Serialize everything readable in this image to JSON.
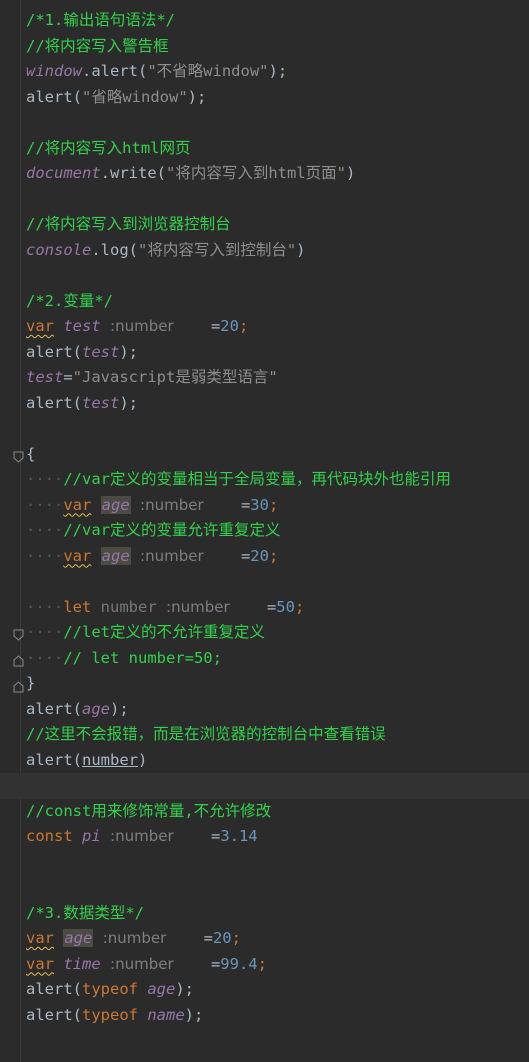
{
  "lines": {
    "l1": "/*1.输出语句语法*/",
    "l2": "//将内容写入警告框",
    "l3a": "window",
    "l3b": ".alert(",
    "l3c": "\"不省略window\"",
    "l3d": ");",
    "l4a": "alert(",
    "l4b": "\"省略window\"",
    "l4c": ");",
    "l6": "//将内容写入html网页",
    "l7a": "document",
    "l7b": ".write(",
    "l7c": "\"将内容写入到html页面\"",
    "l7d": ")",
    "l9": "//将内容写入到浏览器控制台",
    "l10a": "console",
    "l10b": ".log(",
    "l10c": "\"将内容写入到控制台\"",
    "l10d": ")",
    "l12": "/*2.变量*/",
    "l13a": "var",
    "l13b": "test",
    "l13hint": ":number",
    "l13c": "=",
    "l13d": "20",
    "l13e": ";",
    "l14a": "alert(",
    "l14b": "test",
    "l14c": ");",
    "l15a": "test",
    "l15b": "=",
    "l15c": "\"Javascript是弱类型语言\"",
    "l16a": "alert(",
    "l16b": "test",
    "l16c": ");",
    "l18": "{",
    "l19": "//var定义的变量相当于全局变量，再代码块外也能引用",
    "l20a": "var",
    "l20b": "age",
    "l20hint": ":number",
    "l20c": "=",
    "l20d": "30",
    "l20e": ";",
    "l21": "//var定义的变量允许重复定义",
    "l22a": "var",
    "l22b": "age",
    "l22hint": ":number",
    "l22c": "=",
    "l22d": "20",
    "l22e": ";",
    "l24a": "let",
    "l24b": "number",
    "l24hint": ":number",
    "l24c": "=",
    "l24d": "50",
    "l24e": ";",
    "l25": "//let定义的不允许重复定义",
    "l26": "// let number=50;",
    "l27": "}",
    "l28a": "alert(",
    "l28b": "age",
    "l28c": ");",
    "l29": "//这里不会报错，而是在浏览器的控制台中查看错误",
    "l30a": "alert(",
    "l30b": "number",
    "l30c": ")",
    "l32": "//const用来修饰常量,不允许修改",
    "l33a": "const",
    "l33b": "pi",
    "l33hint": ":number",
    "l33c": "=",
    "l33d": "3.14",
    "l36": "/*3.数据类型*/",
    "l37a": "var",
    "l37b": "age",
    "l37hint": ":number",
    "l37c": "=",
    "l37d": "20",
    "l37e": ";",
    "l38a": "var",
    "l38b": "time",
    "l38hint": ":number",
    "l38c": "=",
    "l38d": "99.4",
    "l38e": ";",
    "l39a": "alert(",
    "l39b": "typeof",
    "l39c": "age",
    "l39d": ");",
    "l40a": "alert(",
    "l40b": "typeof",
    "l40c": "name",
    "l40d": ");",
    "dots": "····"
  }
}
